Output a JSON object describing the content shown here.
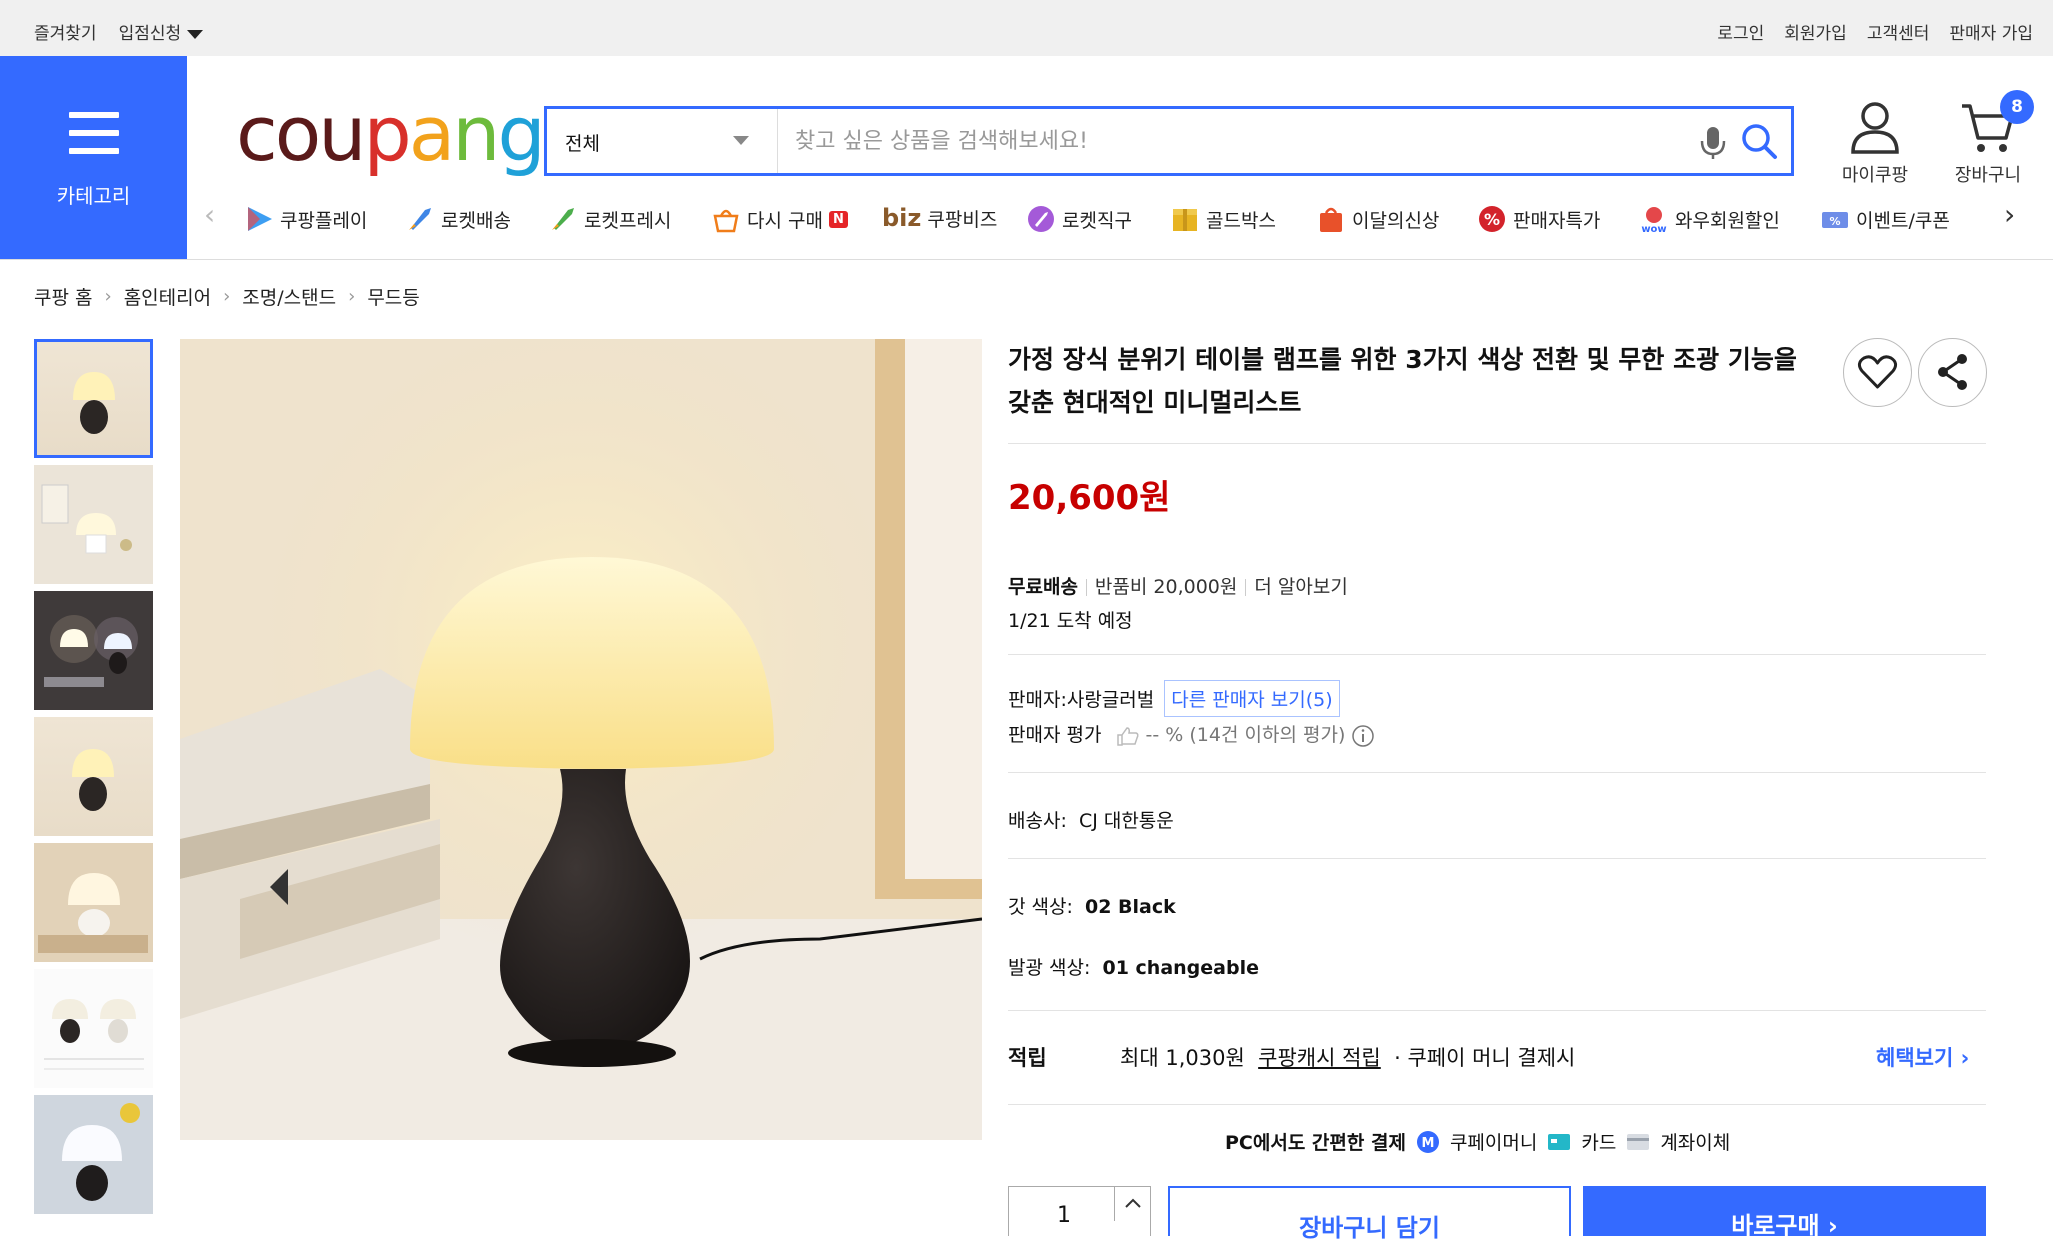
{
  "topbar": {
    "favorites": "즐겨찾기",
    "seller_apply": "입점신청",
    "login": "로그인",
    "signup": "회원가입",
    "customer_center": "고객센터",
    "seller_signup": "판매자 가입"
  },
  "header": {
    "category_label": "카테고리",
    "logo": {
      "c1": "cou",
      "c2": "p",
      "c3": "a",
      "c4": "n",
      "c5": "g"
    },
    "search_scope": "전체",
    "search_placeholder": "찾고 싶은 상품을 검색해보세요!",
    "mycoupang": "마이쿠팡",
    "cart": "장바구니",
    "cart_count": "8"
  },
  "nav": {
    "items": [
      {
        "label": "쿠팡플레이",
        "icon": "play-icon"
      },
      {
        "label": "로켓배송",
        "icon": "rocket-icon"
      },
      {
        "label": "로켓프레시",
        "icon": "rocket-fresh-icon"
      },
      {
        "label": "다시 구매",
        "icon": "rebuy-icon",
        "badge": "N"
      },
      {
        "label": "쿠팡비즈",
        "icon": "biz-icon",
        "prefix": "biz"
      },
      {
        "label": "로켓직구",
        "icon": "rocket-global-icon"
      },
      {
        "label": "골드박스",
        "icon": "goldbox-icon"
      },
      {
        "label": "이달의신상",
        "icon": "new-bag-icon"
      },
      {
        "label": "판매자특가",
        "icon": "percent-icon"
      },
      {
        "label": "와우회원할인",
        "icon": "wow-icon"
      },
      {
        "label": "이벤트/쿠폰",
        "icon": "coupon-icon"
      }
    ]
  },
  "breadcrumb": [
    "쿠팡 홈",
    "홈인테리어",
    "조명/스탠드",
    "무드등"
  ],
  "product": {
    "title": "가정 장식 분위기 테이블 램프를 위한 3가지 색상 전환 및 무한 조광 기능을 갖춘 현대적인 미니멀리스트",
    "price": "20,600원",
    "shipping": "무료배송",
    "return_fee": "반품비 20,000원",
    "learn_more": "더 알아보기",
    "arrival": "1/21 도착 예정",
    "seller_label": "판매자:",
    "seller_name": "사랑글러벌",
    "other_sellers": "다른 판매자 보기(5)",
    "seller_rating_label": "판매자 평가",
    "seller_rating": "-- % (14건 이하의 평가)",
    "courier_label": "배송사:",
    "courier": "CJ 대한통운",
    "shade_color_label": "갓 색상:",
    "shade_color": "02 Black",
    "light_color_label": "발광 색상:",
    "light_color": "01 changeable",
    "reward_label": "적립",
    "reward_max": "최대 1,030원",
    "reward_cash": "쿠팡캐시 적립",
    "reward_cond": "· 쿠페이 머니 결제시",
    "benefits": "혜택보기",
    "pay_title": "PC에서도 간편한 결제",
    "pay_money": "쿠페이머니",
    "pay_card": "카드",
    "pay_bank": "계좌이체",
    "quantity": "1",
    "add_to_cart": "장바구니 담기",
    "buy_now": "바로구매"
  }
}
